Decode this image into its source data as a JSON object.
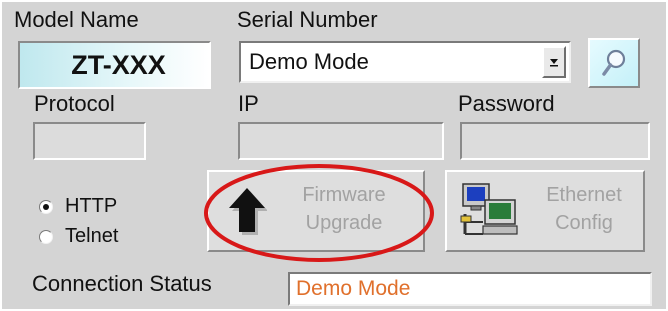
{
  "model": {
    "label": "Model Name",
    "value": "ZT-XXX"
  },
  "serial": {
    "label": "Serial Number",
    "value": "Demo Mode"
  },
  "protocol": {
    "label": "Protocol",
    "options": [
      "HTTP",
      "Telnet"
    ],
    "selected": "HTTP"
  },
  "ip": {
    "label": "IP",
    "value": ""
  },
  "password": {
    "label": "Password",
    "value": ""
  },
  "firmware_button": {
    "line1": "Firmware",
    "line2": "Upgrade"
  },
  "ethernet_button": {
    "line1": "Ethernet",
    "line2": "Config"
  },
  "connection": {
    "label": "Connection Status",
    "value": "Demo Mode"
  },
  "icons": {
    "search": "magnifier-icon",
    "dropdown": "chevron-down-icon",
    "firmware": "upload-arrow-icon",
    "ethernet": "network-computers-icon"
  },
  "colors": {
    "panel": "#d4d4d4",
    "status_text": "#e0702c",
    "highlight": "#d81818",
    "model_box": "#bfe8ee"
  }
}
